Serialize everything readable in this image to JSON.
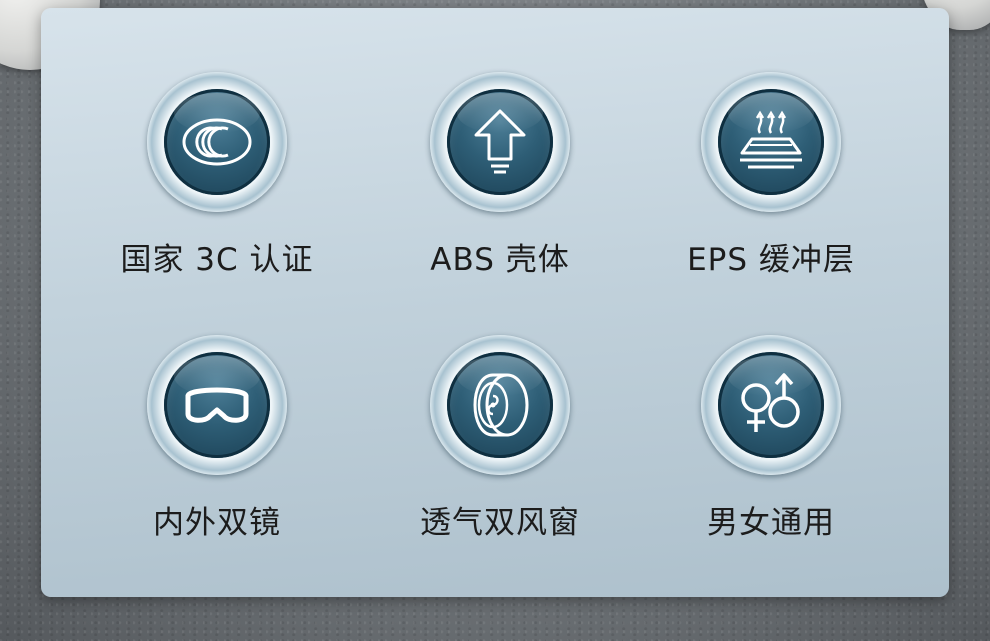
{
  "features": [
    {
      "label": "国家 3C 认证",
      "icon": "ccc-certification-icon"
    },
    {
      "label": "ABS 壳体",
      "icon": "upload-arrow-icon"
    },
    {
      "label": "EPS 缓冲层",
      "icon": "heat-layer-icon"
    },
    {
      "label": "内外双镜",
      "icon": "goggles-icon"
    },
    {
      "label": "透气双风窗",
      "icon": "ventilation-fan-icon"
    },
    {
      "label": "男女通用",
      "icon": "gender-symbols-icon"
    }
  ],
  "colors": {
    "panel": "#c2d2dc",
    "badge_core": "#2e5e76",
    "label_text": "#1c1c1c"
  }
}
